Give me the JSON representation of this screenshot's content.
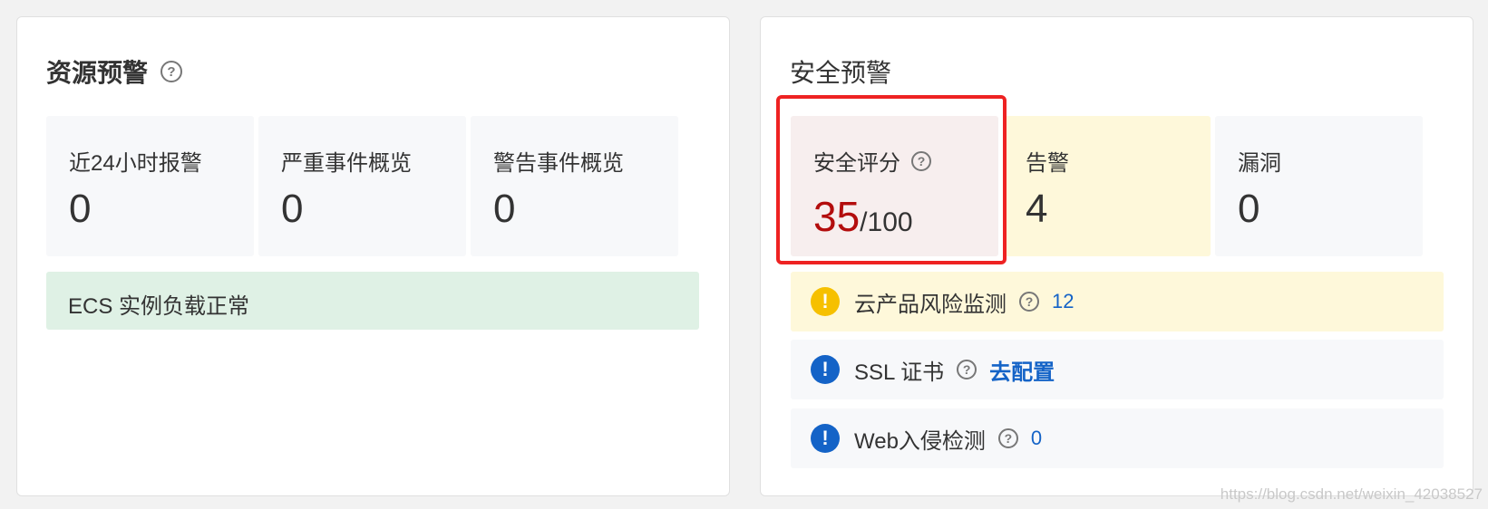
{
  "resource": {
    "title": "资源预警",
    "stats": [
      {
        "label": "近24小时报警",
        "value": "0"
      },
      {
        "label": "严重事件概览",
        "value": "0"
      },
      {
        "label": "警告事件概览",
        "value": "0"
      }
    ],
    "status": "ECS 实例负载正常"
  },
  "security": {
    "title": "安全预警",
    "score": {
      "label": "安全评分",
      "value": "35",
      "total": "/100"
    },
    "alerts": {
      "label": "告警",
      "value": "4"
    },
    "vulns": {
      "label": "漏洞",
      "value": "0"
    },
    "rows": [
      {
        "label": "云产品风险监测",
        "count": "12"
      },
      {
        "label": "SSL 证书",
        "link": "去配置"
      },
      {
        "label": "Web入侵检测",
        "count": "0"
      }
    ]
  },
  "watermark": "https://blog.csdn.net/weixin_42038527",
  "colors": {
    "score_red": "#b30d0d",
    "link_blue": "#1463c7",
    "warn_yellow": "#f6c000",
    "ok_green_bg": "#dff1e5",
    "highlight_border": "#ee2222"
  }
}
